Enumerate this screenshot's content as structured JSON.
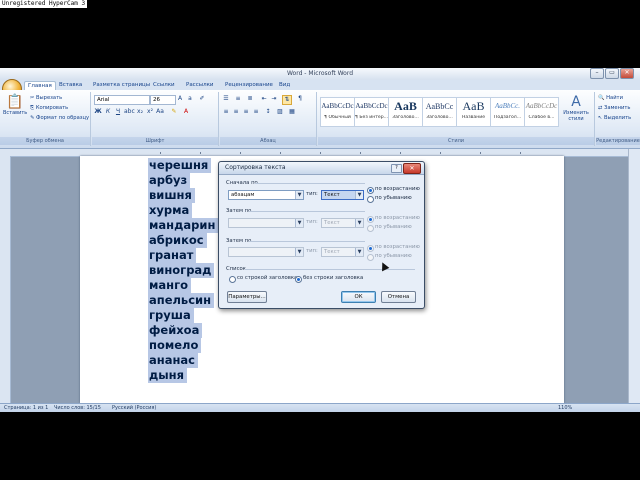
{
  "watermark": "Unregistered HyperCam 3",
  "window": {
    "title": "Word - Microsoft Word",
    "controls": [
      "–",
      "▭",
      "✕"
    ]
  },
  "ribbon": {
    "tabs": [
      "Главная",
      "Вставка",
      "Разметка страницы",
      "Ссылки",
      "Рассылки",
      "Рецензирование",
      "Вид"
    ],
    "clipboard": {
      "paste": "Вставить",
      "cut": "Вырезать",
      "copy": "Копировать",
      "format_painter": "Формат по образцу",
      "label": "Буфер обмена"
    },
    "font": {
      "name": "Arial",
      "size": "26",
      "label": "Шрифт"
    },
    "paragraph": {
      "label": "Абзац"
    },
    "styles": {
      "items": [
        {
          "sample": "AaBbCcDc",
          "name": "¶ Обычный"
        },
        {
          "sample": "AaBbCcDc",
          "name": "¶ Без интер..."
        },
        {
          "sample": "AaB",
          "name": "Заголово..."
        },
        {
          "sample": "AaBbCc",
          "name": "Заголово..."
        },
        {
          "sample": "AaB",
          "name": "Название"
        },
        {
          "sample": "AaBbCc.",
          "name": "Подзагол..."
        },
        {
          "sample": "AaBbCcDc",
          "name": "Слабое в..."
        }
      ],
      "change": "Изменить стили",
      "label": "Стили"
    },
    "editing": {
      "find": "Найти",
      "replace": "Заменить",
      "select": "Выделить",
      "label": "Редактирование"
    }
  },
  "document": {
    "lines": [
      "черешня",
      "арбуз",
      "вишня",
      "хурма",
      "мандарин",
      "абрикос",
      "гранат",
      "виноград",
      "манго",
      "апельсин",
      "груша",
      "фейхоа",
      "помело",
      "ананас",
      "дыня"
    ]
  },
  "dialog": {
    "title": "Сортировка текста",
    "first_by_label": "Сначала по",
    "first_by_value": "абзацам",
    "type_label": "тип:",
    "type_value": "Текст",
    "then_by_label": "Затем по",
    "then_by2_label": "Затем по",
    "then_value": "",
    "asc": "по возрастанию",
    "desc": "по убыванию",
    "list_label": "Список",
    "with_header": "со строкой заголовка",
    "without_header": "без строки заголовка",
    "params_button": "Параметры...",
    "ok_button": "ОК",
    "cancel_button": "Отмена",
    "help": "?",
    "close": "✕"
  },
  "status": {
    "page": "Страница: 1 из 1",
    "words": "Число слов: 15/15",
    "language": "Русский (Россия)",
    "zoom": "110%"
  }
}
